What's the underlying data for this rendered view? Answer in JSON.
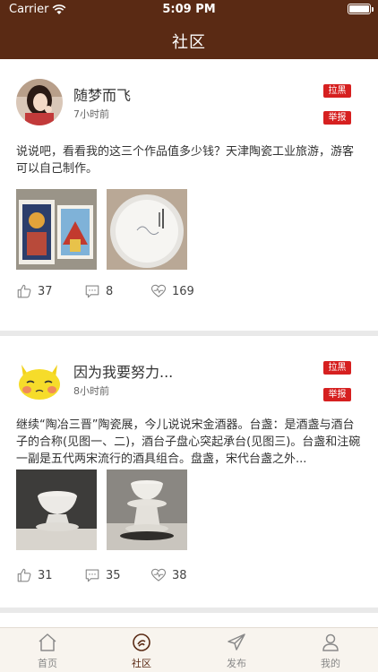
{
  "status_bar": {
    "carrier": "Carrier",
    "time": "5:09 PM"
  },
  "header": {
    "title": "社区"
  },
  "posts": [
    {
      "username": "随梦而飞",
      "time": "7小时前",
      "block_label": "拉黑",
      "report_label": "举报",
      "content": "说说吧，看看我的这三个作品值多少钱？天津陶瓷工业旅游，游客可以自己制作。",
      "likes": "37",
      "comments": "8",
      "favorites": "169"
    },
    {
      "username": "因为我要努力...",
      "time": "8小时前",
      "block_label": "拉黑",
      "report_label": "举报",
      "content": "继续“陶冶三晋”陶瓷展，今儿说说宋金酒器。台盏：是酒盏与酒台子的合称(见图一、二)，酒台子盘心突起承台(见图三)。台盏和注碗一副是五代两宋流行的酒具组合。盘盏，宋代台盏之外...",
      "likes": "31",
      "comments": "35",
      "favorites": "38"
    }
  ],
  "tabbar": {
    "items": [
      {
        "label": "首页",
        "icon": "home-icon"
      },
      {
        "label": "社区",
        "icon": "community-icon"
      },
      {
        "label": "发布",
        "icon": "send-icon"
      },
      {
        "label": "我的",
        "icon": "user-icon"
      }
    ]
  },
  "colors": {
    "header": "#5a2a14",
    "tag": "#d62020",
    "tab_active": "#5a2a14"
  }
}
